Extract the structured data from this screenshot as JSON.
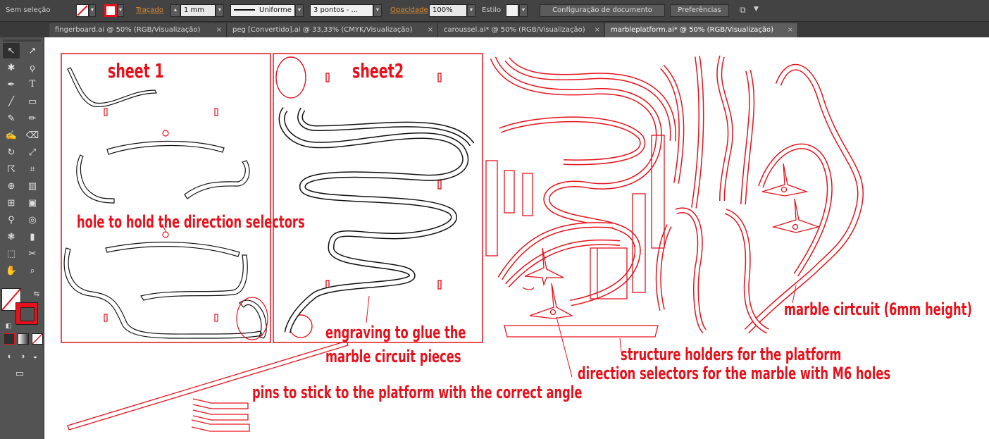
{
  "control_bar": {
    "selection_label": "Sem seleção",
    "stroke_label": "Traçado",
    "stroke_weight": "1 mm",
    "stroke_profile": "Uniforme",
    "brush": "3 pontos - ...",
    "opacity_label": "Opacidade",
    "opacity_value": "100%",
    "style_label": "Estilo",
    "doc_setup_button": "Configuração de documento",
    "preferences_button": "Preferências"
  },
  "tabs": [
    {
      "label": "fingerboard.ai @ 50% (RGB/Visualização)"
    },
    {
      "label": "peg [Convertido].ai @ 33,33% (CMYK/Visualização)"
    },
    {
      "label": "caroussel.ai* @ 50% (RGB/Visualização)"
    },
    {
      "label": "marbleplatform.ai* @ 50% (RGB/Visualização)",
      "active": true
    }
  ],
  "tab_close_glyph": "×",
  "tools": [
    "selection-tool-icon",
    "direct-selection-tool-icon",
    "magic-wand-tool-icon",
    "lasso-tool-icon",
    "pen-tool-icon",
    "type-tool-icon",
    "line-tool-icon",
    "rectangle-tool-icon",
    "paintbrush-tool-icon",
    "pencil-tool-icon",
    "blob-brush-tool-icon",
    "eraser-tool-icon",
    "rotate-tool-icon",
    "scale-tool-icon",
    "warp-tool-icon",
    "free-transform-tool-icon",
    "shape-builder-tool-icon",
    "graph-tool-icon",
    "mesh-tool-icon",
    "gradient-tool-icon",
    "eyedropper-tool-icon",
    "blend-tool-icon",
    "symbol-sprayer-tool-icon",
    "column-graph-tool-icon",
    "artboard-tool-icon",
    "slice-tool-icon",
    "hand-tool-icon",
    "zoom-tool-icon"
  ],
  "colors": {
    "annotation_red": "#e8111b",
    "cut_black": "#111111",
    "panel_dark": "#434343",
    "tool_panel": "#535353"
  },
  "annotations": {
    "sheet1": "sheet 1",
    "sheet2": "sheet2",
    "hole": "hole to hold the direction selectors",
    "engraving_line1": "engraving to glue the",
    "engraving_line2": "marble circuit pieces",
    "structure": "structure holders for the platform",
    "selectors": "direction selectors for the marble with M6 holes",
    "pins": "pins to stick to the platform with the correct angle",
    "circuit": "marble cirtcuit (6mm height)"
  }
}
